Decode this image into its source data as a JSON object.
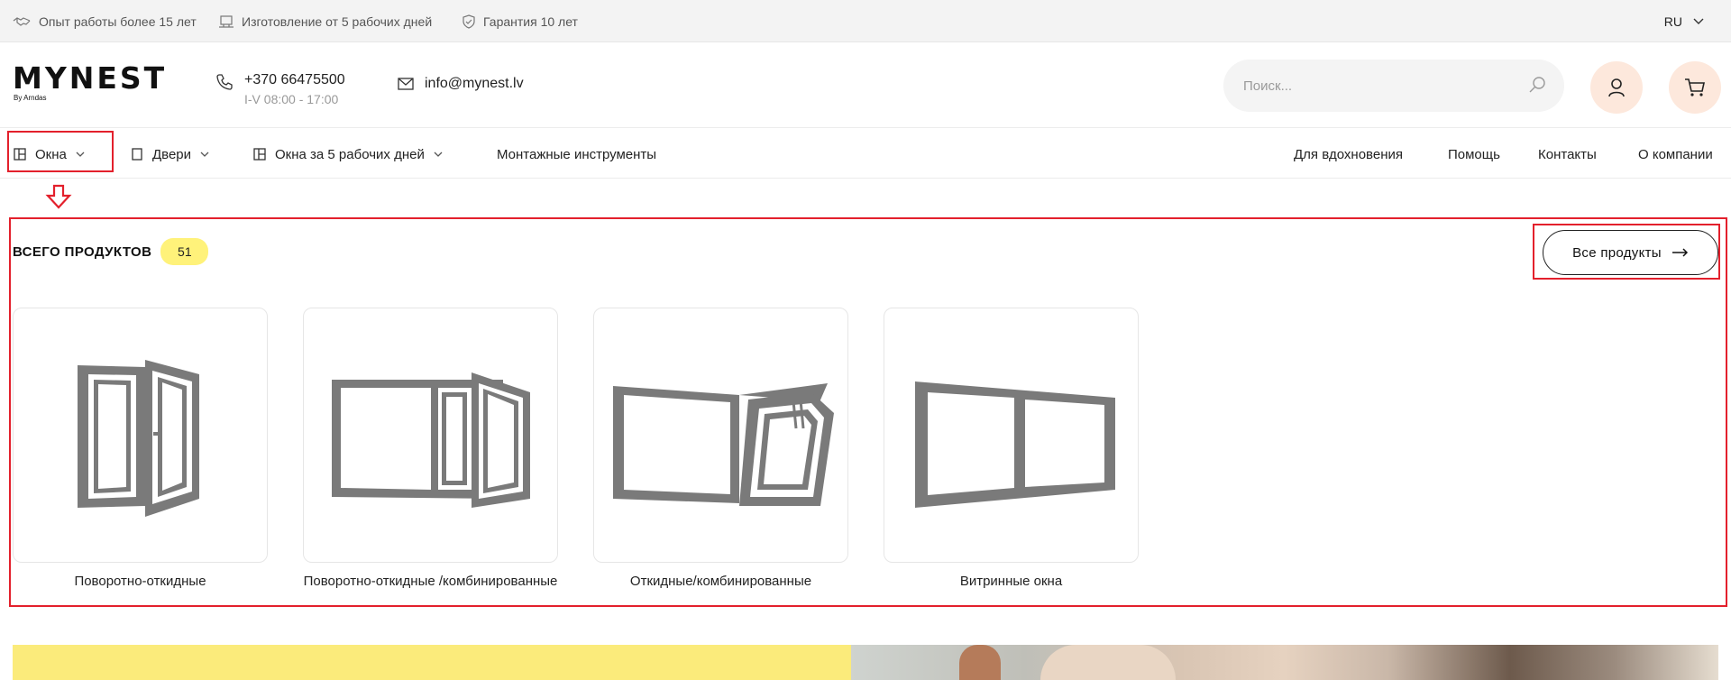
{
  "topbar": {
    "experience": "Опыт работы более 15 лет",
    "production": "Изготовление от 5 рабочих дней",
    "warranty": "Гарантия 10 лет",
    "language": "RU"
  },
  "header": {
    "logo_text": "MYNEST",
    "logo_sub": "By Arndas",
    "phone": "+370 66475500",
    "hours": "I-V 08:00 - 17:00",
    "email": "info@mynest.lv",
    "search_placeholder": "Поиск..."
  },
  "nav": {
    "left": [
      {
        "label": "Окна",
        "icon": "window-icon",
        "dropdown": true
      },
      {
        "label": "Двери",
        "icon": "door-icon",
        "dropdown": true
      },
      {
        "label": "Окна за 5 рабочих дней",
        "icon": "window-icon",
        "dropdown": true
      },
      {
        "label": "Монтажные инструменты",
        "icon": null,
        "dropdown": false
      }
    ],
    "right": [
      "Для вдохновения",
      "Помощь",
      "Контакты",
      "О компании"
    ]
  },
  "products": {
    "total_label": "ВСЕГО ПРОДУКТОВ",
    "total_count": "51",
    "all_button": "Все продукты",
    "items": [
      {
        "label": "Поворотно-откидные"
      },
      {
        "label": "Поворотно-откидные /комбинированные"
      },
      {
        "label": "Откидные/комбинированные"
      },
      {
        "label": "Витринные окна"
      }
    ]
  },
  "colors": {
    "accent_badge": "#fff27a",
    "highlight": "#e3202c",
    "icon_button_bg": "#fde8dc",
    "banner_yellow": "#fbeb7b"
  }
}
